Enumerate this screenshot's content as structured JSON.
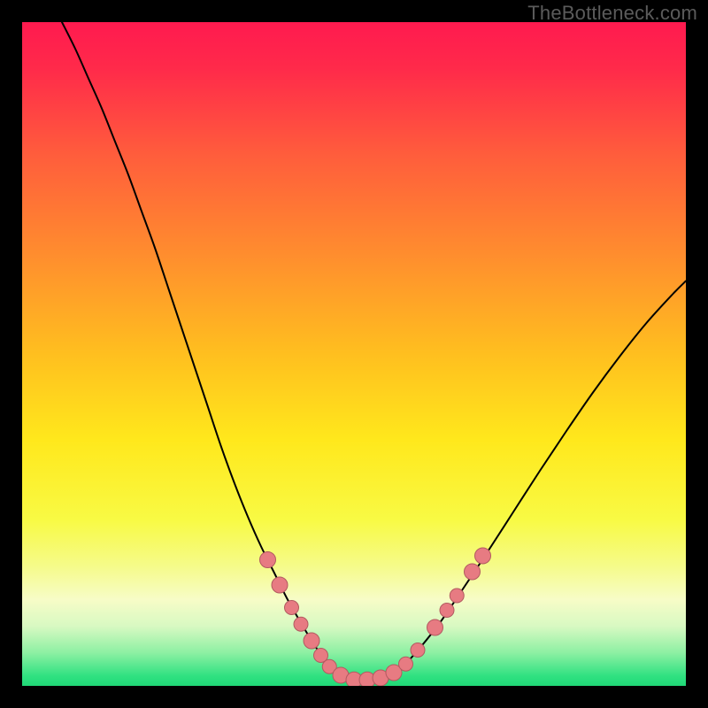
{
  "watermark": "TheBottleneck.com",
  "chart_data": {
    "type": "line",
    "title": "",
    "xlabel": "",
    "ylabel": "",
    "xlim": [
      0,
      100
    ],
    "ylim": [
      0,
      100
    ],
    "background_gradient": {
      "stops": [
        {
          "offset": 0.0,
          "color": "#ff1a4f"
        },
        {
          "offset": 0.07,
          "color": "#ff2a4a"
        },
        {
          "offset": 0.2,
          "color": "#ff5d3c"
        },
        {
          "offset": 0.35,
          "color": "#ff8d2e"
        },
        {
          "offset": 0.5,
          "color": "#ffbf1f"
        },
        {
          "offset": 0.63,
          "color": "#ffe81c"
        },
        {
          "offset": 0.75,
          "color": "#f8fa44"
        },
        {
          "offset": 0.82,
          "color": "#f5fb8a"
        },
        {
          "offset": 0.87,
          "color": "#f7fcc7"
        },
        {
          "offset": 0.91,
          "color": "#d8f9c2"
        },
        {
          "offset": 0.95,
          "color": "#8df0a3"
        },
        {
          "offset": 0.985,
          "color": "#30e181"
        },
        {
          "offset": 1.0,
          "color": "#20d877"
        }
      ]
    },
    "series": [
      {
        "name": "bottleneck-curve",
        "color": "#000000",
        "stroke_width": 2.0,
        "x": [
          6,
          8,
          10,
          12,
          14,
          16,
          18,
          20,
          22,
          24,
          26,
          28,
          30,
          32,
          34,
          36,
          38,
          40,
          42,
          44,
          45,
          46,
          47,
          48,
          49,
          50,
          51,
          52,
          53,
          54,
          56,
          58,
          60,
          63,
          66,
          70,
          74,
          78,
          82,
          86,
          90,
          94,
          98,
          100
        ],
        "y": [
          100,
          96,
          91.5,
          87,
          82,
          77,
          71.5,
          66,
          60,
          54,
          48,
          42,
          36,
          30.5,
          25.5,
          21,
          17,
          13,
          9.5,
          6.2,
          4.8,
          3.6,
          2.6,
          1.8,
          1.2,
          0.8,
          0.7,
          0.7,
          0.8,
          1.0,
          2.0,
          3.6,
          5.8,
          9.6,
          14,
          20,
          26.2,
          32.4,
          38.4,
          44.2,
          49.6,
          54.6,
          59,
          61
        ]
      }
    ],
    "markers": {
      "color": "#e77b82",
      "stroke": "#b25a60",
      "points": [
        {
          "x": 37.0,
          "y": 19.0,
          "r": 9
        },
        {
          "x": 38.8,
          "y": 15.2,
          "r": 9
        },
        {
          "x": 40.6,
          "y": 11.8,
          "r": 8
        },
        {
          "x": 42.0,
          "y": 9.3,
          "r": 8
        },
        {
          "x": 43.6,
          "y": 6.8,
          "r": 9
        },
        {
          "x": 45.0,
          "y": 4.6,
          "r": 8
        },
        {
          "x": 46.3,
          "y": 2.9,
          "r": 8
        },
        {
          "x": 48.0,
          "y": 1.6,
          "r": 9
        },
        {
          "x": 50.0,
          "y": 0.9,
          "r": 9
        },
        {
          "x": 52.0,
          "y": 0.9,
          "r": 9
        },
        {
          "x": 54.0,
          "y": 1.2,
          "r": 9
        },
        {
          "x": 56.0,
          "y": 2.0,
          "r": 9
        },
        {
          "x": 57.8,
          "y": 3.3,
          "r": 8
        },
        {
          "x": 59.6,
          "y": 5.4,
          "r": 8
        },
        {
          "x": 62.2,
          "y": 8.8,
          "r": 9
        },
        {
          "x": 64.0,
          "y": 11.4,
          "r": 8
        },
        {
          "x": 65.5,
          "y": 13.6,
          "r": 8
        },
        {
          "x": 67.8,
          "y": 17.2,
          "r": 9
        },
        {
          "x": 69.4,
          "y": 19.6,
          "r": 9
        }
      ]
    }
  }
}
